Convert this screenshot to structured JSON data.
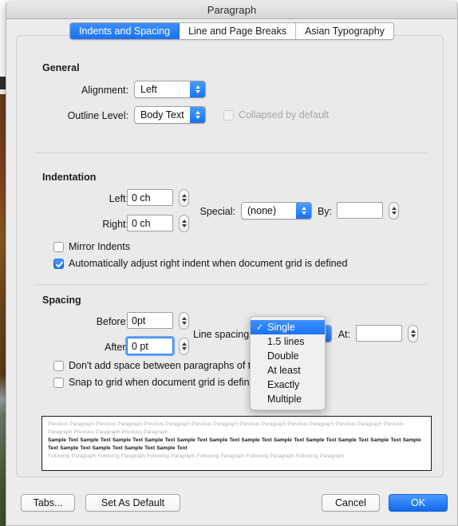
{
  "window": {
    "title": "Paragraph"
  },
  "tabs": [
    {
      "label": "Indents and Spacing",
      "active": true
    },
    {
      "label": "Line and Page Breaks",
      "active": false
    },
    {
      "label": "Asian Typography",
      "active": false
    }
  ],
  "general": {
    "heading": "General",
    "alignment_label": "Alignment:",
    "alignment_value": "Left",
    "outline_label": "Outline Level:",
    "outline_value": "Body Text",
    "collapsed_label": "Collapsed by default"
  },
  "indentation": {
    "heading": "Indentation",
    "left_label": "Left:",
    "left_value": "0 ch",
    "right_label": "Right:",
    "right_value": "0 ch",
    "special_label": "Special:",
    "special_value": "(none)",
    "by_label": "By:",
    "by_value": "",
    "mirror_label": "Mirror Indents",
    "autoadjust_label": "Automatically adjust right indent when document grid is defined"
  },
  "spacing": {
    "heading": "Spacing",
    "before_label": "Before:",
    "before_value": "0pt",
    "after_label": "After:",
    "after_value": "0 pt",
    "linespacing_label": "Line spacing:",
    "at_label": "At:",
    "at_value": "",
    "dontadd_label": "Don't add space between paragraphs of the same style",
    "snapgrid_label": "Snap to grid when document grid is defined"
  },
  "linespacing_menu": {
    "selected": "Single",
    "checkmark": "✓",
    "items": [
      "Single",
      "1.5 lines",
      "Double",
      "At least",
      "Exactly",
      "Multiple"
    ]
  },
  "preview": {
    "previous": "Previous Paragraph Previous Paragraph Previous Paragraph Previous Paragraph Previous Paragraph Previous Paragraph Previous Paragraph Previous Paragraph Previous Paragraph Previous Paragraph",
    "sample": "Sample Text Sample Text Sample Text Sample Text Sample Text Sample Text Sample Text Sample Text Sample Text Sample Text Sample Text Sample Text Sample Text Sample Text Sample Text Sample Text",
    "following": "Following Paragraph Following Paragraph Following Paragraph Following Paragraph Following Paragraph Following Paragraph"
  },
  "buttons": {
    "tabs": "Tabs...",
    "set_as_default": "Set As Default",
    "cancel": "Cancel",
    "ok": "OK"
  },
  "colors": {
    "accent": "#1a72f0",
    "window_bg": "#ececec",
    "panel_bg": "#eaeaea"
  }
}
